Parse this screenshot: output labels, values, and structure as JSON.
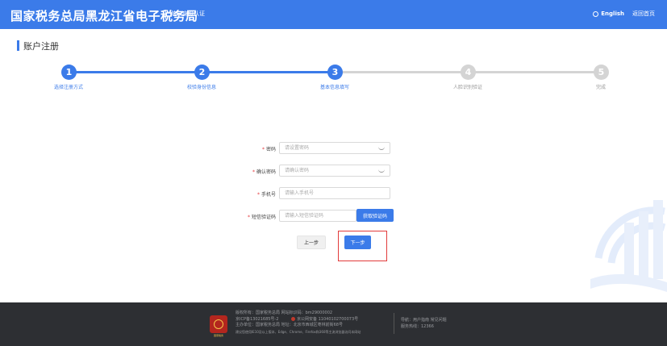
{
  "header": {
    "title": "国家税务总局黑龙江省电子税务局",
    "subtitle": "统一身份认证",
    "lang_label": "English",
    "home_label": "返回首页"
  },
  "page": {
    "title": "账户注册"
  },
  "steps": [
    {
      "num": "1",
      "label": "选择注册方式",
      "state": "done"
    },
    {
      "num": "2",
      "label": "校验身份信息",
      "state": "done"
    },
    {
      "num": "3",
      "label": "基本信息填写",
      "state": "active"
    },
    {
      "num": "4",
      "label": "人脸识别验证",
      "state": "pending"
    },
    {
      "num": "5",
      "label": "完成",
      "state": "pending"
    }
  ],
  "form": {
    "password_label": "密码",
    "password_placeholder": "请设置密码",
    "confirm_label": "确认密码",
    "confirm_placeholder": "请确认密码",
    "phone_label": "手机号",
    "phone_placeholder": "请输入手机号",
    "sms_label": "短信验证码",
    "sms_placeholder": "请输入短信验证码",
    "get_code_label": "获取验证码",
    "prev_label": "上一步",
    "next_label": "下一步"
  },
  "footer": {
    "emblem_caption": "国家税务",
    "col1": [
      "版权所有：国家税务总局   网站标识码：bm29000002",
      "京ICP备13021685号-2",
      "主办单位：国家税务总局   地址：北京市西城区枣林前街68号",
      "建议您使用IE10及以上版本、Edge、Chrome、Firefox和360等主流浏览器访问本网站"
    ],
    "police_record": "京公网安备 11040102700073号",
    "col2": [
      "导航：用户指南   常见问题",
      "服务热线：12366"
    ]
  },
  "colors": {
    "primary": "#3b7be9",
    "pending": "#d4d4d4",
    "highlight": "#e23b3b",
    "footer_bg": "#2d2f33"
  },
  "icons": {
    "lang": "globe-icon",
    "eye": "eye-closed-icon",
    "emblem": "tax-emblem-icon",
    "watermark": "tax-logo-watermark"
  }
}
